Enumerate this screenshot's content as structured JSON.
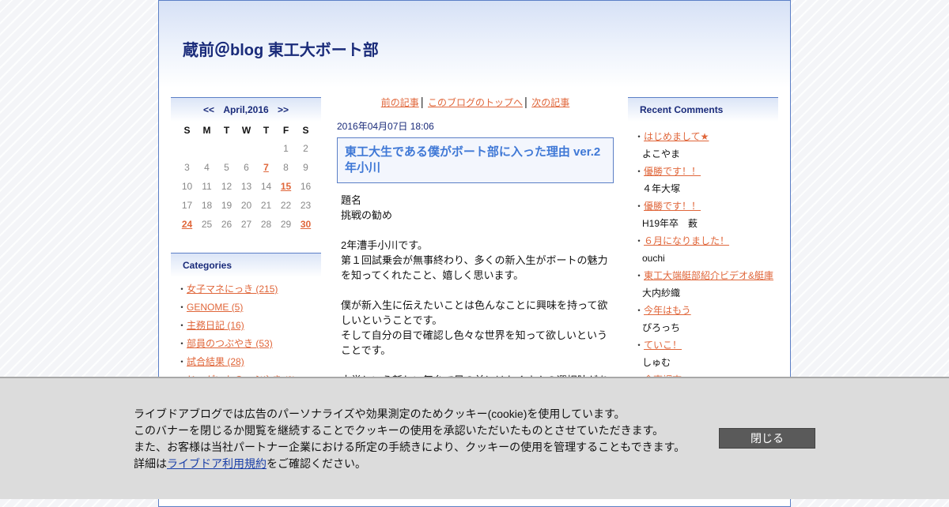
{
  "blog_title": "蔵前＠blog 東工大ボート部",
  "calendar": {
    "prev": "<<",
    "month_label": "April,2016",
    "next": ">>",
    "weekdays": [
      "S",
      "M",
      "T",
      "W",
      "T",
      "F",
      "S"
    ],
    "weeks": [
      [
        "",
        "",
        "",
        "",
        "",
        "1",
        "2"
      ],
      [
        "3",
        "4",
        "5",
        "6",
        "7",
        "8",
        "9"
      ],
      [
        "10",
        "11",
        "12",
        "13",
        "14",
        "15",
        "16"
      ],
      [
        "17",
        "18",
        "19",
        "20",
        "21",
        "22",
        "23"
      ],
      [
        "24",
        "25",
        "26",
        "27",
        "28",
        "29",
        "30"
      ]
    ],
    "linked_days": [
      "7",
      "15",
      "24",
      "30"
    ]
  },
  "categories": {
    "title": "Categories",
    "items": [
      "女子マネにっき (215)",
      "GENOME (5)",
      "主務日記 (16)",
      "部員のつぶやき (53)",
      "試合結果 (28)",
      "じゃがいものつぶやき (9)"
    ]
  },
  "post_nav": {
    "prev": "前の記事",
    "top": "このブログのトップへ",
    "next": "次の記事",
    "separator": "|"
  },
  "post": {
    "date": "2016年04月07日 18:06",
    "title": "東工大生である僕がボート部に入った理由 ver.2年小川",
    "paragraphs": [
      [
        "題名",
        "挑戦の勧め"
      ],
      [
        "2年漕手小川です。",
        "第１回試乗会が無事終わり、多くの新入生がボートの魅力を知ってくれたこと、嬉しく思います。"
      ],
      [
        "僕が新入生に伝えたいことは色んなことに興味を持って欲しいということです。",
        "そして自分の目で確認し色々な世界を知って欲しいということです。"
      ],
      [
        "大学という新しい舞台で目の前にはたくさんの選択肢があります。"
      ]
    ]
  },
  "recent_comments": {
    "title": "Recent Comments",
    "items": [
      {
        "title": "はじめまして★",
        "author": "よこやま"
      },
      {
        "title": "優勝です！！",
        "author": "４年大塚"
      },
      {
        "title": "優勝です！！",
        "author": "H19年卒　薮"
      },
      {
        "title": "６月になりました！",
        "author": "ouchi"
      },
      {
        "title": "東工大端艇部紹介ビデオ&艇庫",
        "author": "大内紗織"
      },
      {
        "title": "今年はもう",
        "author": "ぴろっち"
      },
      {
        "title": "ていこ！",
        "author": "しゅむ"
      },
      {
        "title": "食事調査",
        "author": ""
      }
    ]
  },
  "cookie_banner": {
    "line1": "ライブドアブログでは広告のパーソナライズや効果測定のためクッキー(cookie)を使用しています。",
    "line2": "このバナーを閉じるか閲覧を継続することでクッキーの使用を承認いただいたものとさせていただきます。",
    "line3": "また、お客様は当社パートナー企業における所定の手続きにより、クッキーの使用を管理することもできます。",
    "line4_prefix": "詳細は",
    "line4_link": "ライブドア利用規約",
    "line4_suffix": "をご確認ください。",
    "close_label": "閉じる"
  }
}
